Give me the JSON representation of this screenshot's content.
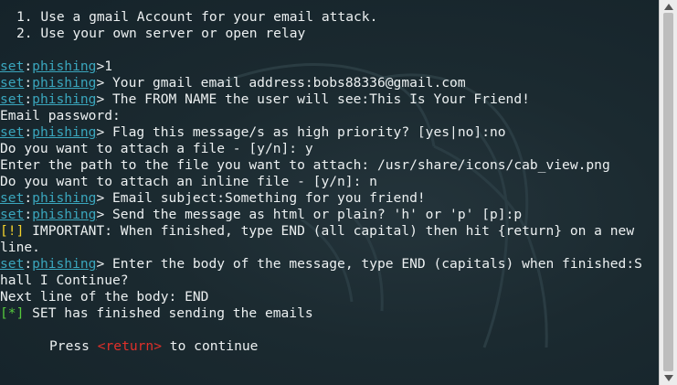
{
  "terminal": {
    "lines": [
      {
        "type": "indent",
        "text": "1. Use a gmail Account for your email attack."
      },
      {
        "type": "indent",
        "text": "2. Use your own server or open relay"
      },
      {
        "type": "blank"
      },
      {
        "type": "prompt",
        "set": "set",
        "colon": ":",
        "module": "phishing",
        "rest": ">1"
      },
      {
        "type": "prompt",
        "set": "set",
        "colon": ":",
        "module": "phishing",
        "rest": "> Your gmail email address:bobs88336@gmail.com"
      },
      {
        "type": "prompt",
        "set": "set",
        "colon": ":",
        "module": "phishing",
        "rest": "> The FROM NAME the user will see:This Is Your Friend!"
      },
      {
        "type": "plain",
        "text": "Email password:"
      },
      {
        "type": "prompt",
        "set": "set",
        "colon": ":",
        "module": "phishing",
        "rest": "> Flag this message/s as high priority? [yes|no]:no"
      },
      {
        "type": "plain",
        "text": "Do you want to attach a file - [y/n]: y"
      },
      {
        "type": "plain",
        "text": "Enter the path to the file you want to attach: /usr/share/icons/cab_view.png"
      },
      {
        "type": "plain",
        "text": "Do you want to attach an inline file - [y/n]: n"
      },
      {
        "type": "prompt",
        "set": "set",
        "colon": ":",
        "module": "phishing",
        "rest": "> Email subject:Something for you friend!"
      },
      {
        "type": "prompt",
        "set": "set",
        "colon": ":",
        "module": "phishing",
        "rest": "> Send the message as html or plain? 'h' or 'p' [p]:p"
      },
      {
        "type": "warning",
        "tag": "[!]",
        "text": " IMPORTANT: When finished, type END (all capital) then hit {return} on a new"
      },
      {
        "type": "plain",
        "text": "line."
      },
      {
        "type": "prompt",
        "set": "set",
        "colon": ":",
        "module": "phishing",
        "rest": "> Enter the body of the message, type END (capitals) when finished:S"
      },
      {
        "type": "plain",
        "text": "hall I Continue?"
      },
      {
        "type": "plain",
        "text": "Next line of the body: END"
      },
      {
        "type": "success",
        "tag": "[*]",
        "text": " SET has finished sending the emails"
      },
      {
        "type": "blank"
      },
      {
        "type": "press",
        "before": "Press ",
        "key": "<return>",
        "after": " to continue"
      }
    ]
  },
  "colors": {
    "background": "#1b2b31",
    "prompt": "#3aa6bd",
    "warning": "#f2d12c",
    "success": "#55c93c",
    "return_key": "#e0302a"
  }
}
